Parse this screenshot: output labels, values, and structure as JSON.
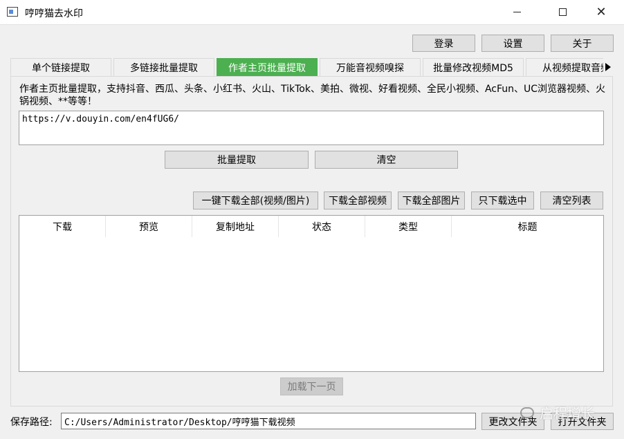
{
  "window": {
    "title": "哼哼猫去水印"
  },
  "topbar": {
    "login_label": "登录",
    "settings_label": "设置",
    "about_label": "关于"
  },
  "tabs": [
    {
      "label": "单个链接提取"
    },
    {
      "label": "多链接批量提取"
    },
    {
      "label": "作者主页批量提取",
      "active": true
    },
    {
      "label": "万能音视频嗅探"
    },
    {
      "label": "批量修改视频MD5"
    },
    {
      "label": "从视频提取音频"
    }
  ],
  "main": {
    "description": "作者主页批量提取，支持抖音、西瓜、头条、小红书、火山、TikTok、美拍、微视、好看视频、全民小视频、AcFun、UC浏览器视频、火锅视频、**等等！",
    "url_value": "https://v.douyin.com/en4fUG6/",
    "extract_label": "批量提取",
    "clear_label": "清空"
  },
  "actions": {
    "download_all_label": "一键下载全部(视频/图片)",
    "download_videos_label": "下载全部视频",
    "download_images_label": "下载全部图片",
    "download_selected_label": "只下载选中",
    "clear_list_label": "清空列表"
  },
  "table": {
    "columns": [
      "下载",
      "预览",
      "复制地址",
      "状态",
      "类型",
      "标题"
    ]
  },
  "load_next_label": "加载下一页",
  "footer": {
    "save_path_label": "保存路径:",
    "save_path_value": "C:/Users/Administrator/Desktop/哼哼猫下载视频",
    "change_folder_label": "更改文件夹",
    "open_folder_label": "打开文件夹"
  },
  "watermark": {
    "text": "启程增长"
  },
  "colors": {
    "active_tab": "#4caf50"
  }
}
